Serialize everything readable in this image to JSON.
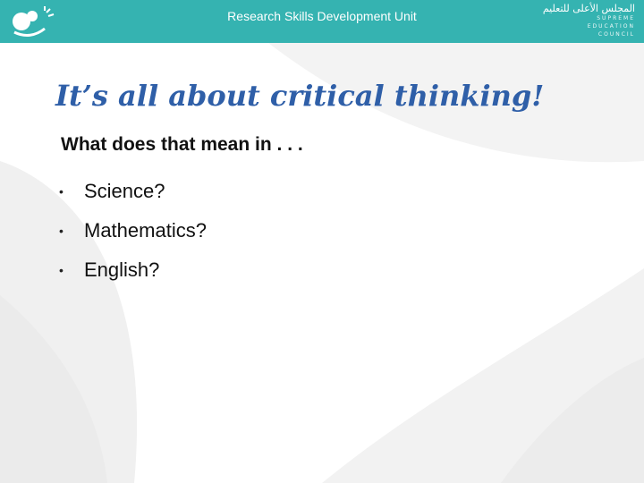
{
  "header": {
    "title": "Research Skills Development Unit",
    "right_logo_arabic": "المجلس الأعلى للتعليم",
    "right_logo_lines": [
      "SUPREME",
      "EDUCATION",
      "COUNCIL"
    ]
  },
  "slide": {
    "title": "It’s all about critical thinking!",
    "subtitle": "What does that mean in . . .",
    "bullets": [
      "Science?",
      "Mathematics?",
      "English?"
    ]
  },
  "colors": {
    "header_bg": "#35b3b1",
    "title": "#2f5fa8",
    "background_swoosh": "#f0f0f0"
  }
}
